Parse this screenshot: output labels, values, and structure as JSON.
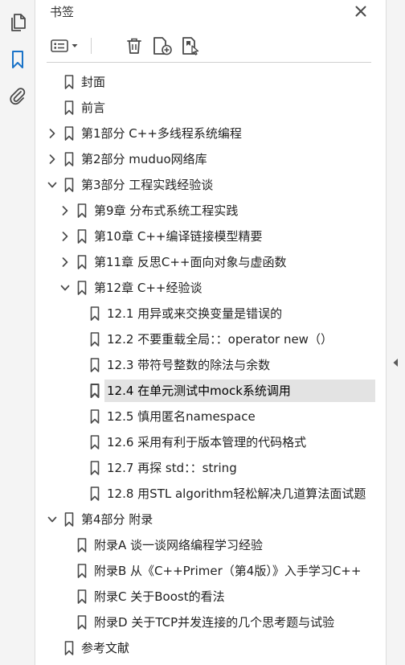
{
  "panel": {
    "title": "书签"
  },
  "colors": {
    "icon": "#4a4a4a",
    "selected_row": "#e3e3e3",
    "rail_bg": "#f4f4f4"
  },
  "tree": [
    {
      "label": "封面",
      "level": 0,
      "expander": "none",
      "selected": false
    },
    {
      "label": "前言",
      "level": 0,
      "expander": "none",
      "selected": false
    },
    {
      "label": "第1部分 C++多线程系统编程",
      "level": 0,
      "expander": "collapsed",
      "selected": false
    },
    {
      "label": "第2部分 muduo网络库",
      "level": 0,
      "expander": "collapsed",
      "selected": false
    },
    {
      "label": "第3部分 工程实践经验谈",
      "level": 0,
      "expander": "expanded",
      "selected": false
    },
    {
      "label": "第9章 分布式系统工程实践",
      "level": 1,
      "expander": "collapsed",
      "selected": false
    },
    {
      "label": "第10章 C++编译链接模型精要",
      "level": 1,
      "expander": "collapsed",
      "selected": false
    },
    {
      "label": "第11章 反思C++面向对象与虚函数",
      "level": 1,
      "expander": "collapsed",
      "selected": false
    },
    {
      "label": "第12章 C++经验谈",
      "level": 1,
      "expander": "expanded",
      "selected": false
    },
    {
      "label": "12.1 用异或来交换变量是错误的",
      "level": 2,
      "expander": "none",
      "selected": false
    },
    {
      "label": "12.2 不要重载全局：：operator new（）",
      "level": 2,
      "expander": "none",
      "selected": false
    },
    {
      "label": "12.3 带符号整数的除法与余数",
      "level": 2,
      "expander": "none",
      "selected": false
    },
    {
      "label": "12.4 在单元测试中mock系统调用",
      "level": 2,
      "expander": "none",
      "selected": true
    },
    {
      "label": "12.5 慎用匿名namespace",
      "level": 2,
      "expander": "none",
      "selected": false
    },
    {
      "label": "12.6 采用有利于版本管理的代码格式",
      "level": 2,
      "expander": "none",
      "selected": false
    },
    {
      "label": "12.7 再探 std：：string",
      "level": 2,
      "expander": "none",
      "selected": false
    },
    {
      "label": "12.8 用STL algorithm轻松解决几道算法面试题",
      "level": 2,
      "expander": "none",
      "selected": false
    },
    {
      "label": "第4部分 附录",
      "level": 0,
      "expander": "expanded",
      "selected": false
    },
    {
      "label": "附录A 谈一谈网络编程学习经验",
      "level": 1,
      "expander": "none",
      "selected": false
    },
    {
      "label": "附录B 从《C++Primer（第4版）》入手学习C++",
      "level": 1,
      "expander": "none",
      "selected": false
    },
    {
      "label": "附录C 关于Boost的看法",
      "level": 1,
      "expander": "none",
      "selected": false
    },
    {
      "label": "附录D 关于TCP并发连接的几个思考题与试验",
      "level": 1,
      "expander": "none",
      "selected": false
    },
    {
      "label": "参考文献",
      "level": 0,
      "expander": "none",
      "selected": false
    }
  ]
}
